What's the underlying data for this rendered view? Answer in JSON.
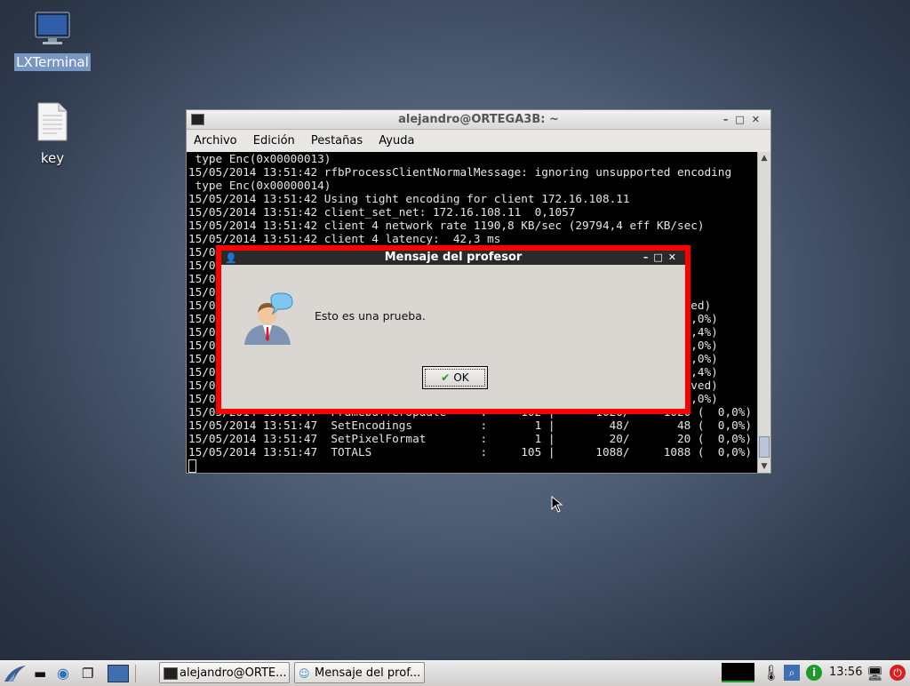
{
  "desktop": {
    "icons": [
      {
        "label": "LXTerminal",
        "icon": "monitor-icon"
      },
      {
        "label": "key",
        "icon": "text-file-icon"
      }
    ]
  },
  "terminal": {
    "title": "alejandro@ORTEGA3B: ~",
    "menu": [
      "Archivo",
      "Edición",
      "Pestañas",
      "Ayuda"
    ],
    "lines": [
      " type Enc(0x00000013)",
      "15/05/2014 13:51:42 rfbProcessClientNormalMessage: ignoring unsupported encoding",
      " type Enc(0x00000014)",
      "15/05/2014 13:51:42 Using tight encoding for client 172.16.108.11",
      "15/05/2014 13:51:42 client_set_net: 172.16.108.11  0,1057",
      "15/05/2014 13:51:42 client 4 network rate 1190,8 KB/sec (29794,4 eff KB/sec)",
      "15/05/2014 13:51:42 client 4 latency:  42,3 ms",
      "15/0",
      "15/0",
      "15/0",
      "15/0",
      "15/0                                                                 ( saved)",
      "15/0                                                                0 (  0,0%)",
      "15/0                                                                0 ( 95,4%)",
      "15/0                                                                2 (  0,0%)",
      "15/0                                                                4 (  0,0%)",
      "15/0                                                                6 ( 95,4%)",
      "15/0                                                                  ( saved)",
      "15/0                                                                  (  0,0%)",
      "15/05/2014 13:51:47  FramebufferUpdate     :     102 |      1020/     1020 (  0,0%)",
      "15/05/2014 13:51:47  SetEncodings          :       1 |        48/       48 (  0,0%)",
      "15/05/2014 13:51:47  SetPixelFormat        :       1 |        20/       20 (  0,0%)",
      "15/05/2014 13:51:47  TOTALS                :     105 |      1088/     1088 (  0,0%)"
    ]
  },
  "dialog": {
    "title": "Mensaje del profesor",
    "message": "Esto es una prueba.",
    "ok_label": "OK",
    "highlight_color": "#ff0000"
  },
  "taskbar": {
    "tasks": [
      {
        "label": "alejandro@ORTE..."
      },
      {
        "label": "Mensaje del prof..."
      }
    ],
    "clock": "13:56"
  }
}
